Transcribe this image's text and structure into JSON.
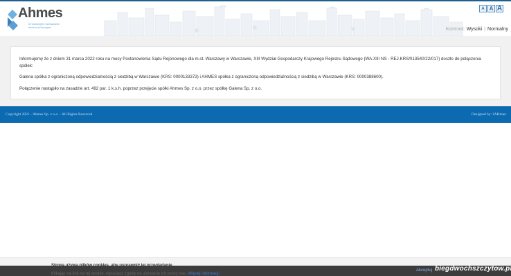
{
  "header": {
    "logo_name": "Ahmes",
    "logo_tagline": "Innowacyjne rozwiązania telekomunikacyjne",
    "font_size_buttons": [
      "A",
      "A",
      "A"
    ],
    "contrast": {
      "label": "Kontrast:",
      "high": "Wysoki",
      "separator": "|",
      "normal": "Normalny"
    }
  },
  "content": {
    "paragraphs": [
      "Informujemy że z dniem 31 marca 2022 roku na mocy Postanowienia Sądu Rejonowego dla m.st. Warszawy w Warszawie, XIII Wydział Gospodarczy Krajowego Rejestru Sądowego (WA.XIII NS - REJ.KRS/013540/22/017) doszło do połączenia spółek:",
      "Galena spółka z ograniczoną odpowiedzialnością z siedzibą w Warszawie (KRS: 0000133373) i AHMES spółka z ograniczoną odpowiedzialnością z siedzibą w Warszawie (KRS: 0000388600).",
      "Połączenie nastąpiło na zasadzie art. 492 par. 1 k.s.h. poprzez przejęcie spółki Ahmes Sp. z o.o. przez spółkę Galena Sp. z o.o."
    ]
  },
  "footer": {
    "copyright": "Copyright 2021 - Ahmes Sp. z o.o. - All Rights Reserved",
    "designed_by": "Designed by: JAHman"
  },
  "cookie": {
    "title": "Strona używa plików cookies, aby usprawnić jej przeglądanie.",
    "text": "Klikając na link na tej stronie, wyrażasz zgodę na używanie ich przez nas.",
    "link": "Więcej informacji",
    "accept": "Akceptuj"
  },
  "watermark": "biegdwochszczytow.pl",
  "colors": {
    "accent": "#0b6ab0",
    "top_line": "#1f5f8b",
    "dark_band": "#3c3c3c"
  }
}
